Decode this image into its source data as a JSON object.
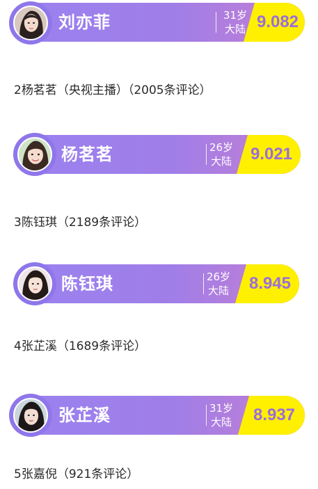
{
  "rankings": [
    {
      "name": "刘亦菲",
      "age": "31岁",
      "region": "大陆",
      "score": "9.082"
    },
    {
      "name": "杨茗茗",
      "age": "26岁",
      "region": "大陆",
      "score": "9.021"
    },
    {
      "name": "陈钰琪",
      "age": "26岁",
      "region": "大陆",
      "score": "8.945"
    },
    {
      "name": "张芷溪",
      "age": "31岁",
      "region": "大陆",
      "score": "8.937"
    }
  ],
  "captions": [
    "2杨茗茗（央视主播）（2005条评论）",
    "3陈钰琪（2189条评论）",
    "4张芷溪（1689条评论）",
    "5张嘉倪（921条评论）"
  ],
  "colors": {
    "card_purple": "#9a82f0",
    "score_yellow": "#fff000",
    "score_text": "#9a6edb"
  }
}
